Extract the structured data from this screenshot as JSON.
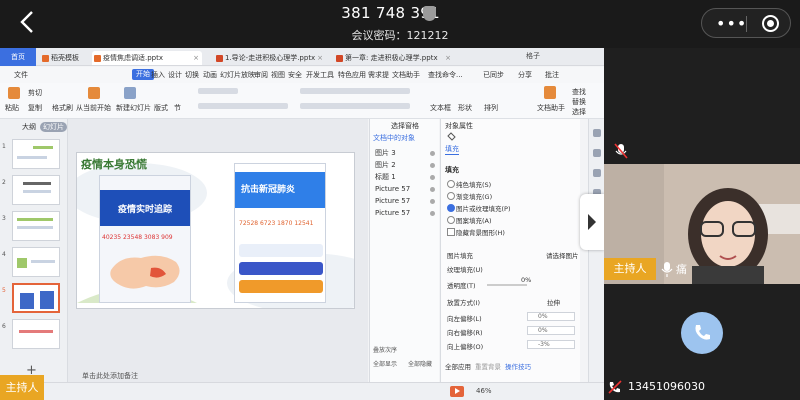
{
  "meeting": {
    "id": "381 748 391",
    "password_label": "会议密码：121212",
    "more_dots": "•••"
  },
  "wps": {
    "tabs": {
      "home": "首页",
      "dochub": "稻壳模板",
      "doc1": "疫情焦虑调适.pptx",
      "doc2": "1.导论-走进积极心理学.pptx",
      "doc3": "第一章: 走进积极心理学.pptx",
      "user": "格子"
    },
    "menus": [
      "文件",
      "开始",
      "插入",
      "设计",
      "切换",
      "动画",
      "幻灯片放映",
      "审阅",
      "视图",
      "安全",
      "开发工具",
      "特色应用",
      "需求提",
      "文档助手",
      "查找命令...",
      "已同步",
      "分享",
      "批注"
    ],
    "active_menu": "开始",
    "ribbon": {
      "paste": "粘贴",
      "cut": "剪切",
      "copy": "复制",
      "format_painter": "格式刷",
      "play_from_current": "从当前开始",
      "new_slide": "新建幻灯片",
      "layout": "版式",
      "section": "节",
      "textbox": "文本框",
      "shape": "形状",
      "arrange": "排列",
      "doc_helper": "文档助手",
      "find": "查找",
      "replace": "替换",
      "select": "选择"
    },
    "thumbs": {
      "outline_tab": "大纲",
      "slides_tab": "幻灯片",
      "numbers": [
        "1",
        "2",
        "3",
        "4",
        "5",
        "6"
      ]
    },
    "slide": {
      "title": "疫情本身恐慌",
      "phone_a_title": "疫情实时追踪",
      "phone_a_nums": "40235  23548  3083  909",
      "phone_b_title": "抗击新冠肺炎",
      "phone_b_nums": "72528  6723  1870  12541"
    },
    "notes_placeholder": "单击此处添加备注",
    "selection_pane": {
      "title": "选择窗格",
      "subtitle": "文档中的对象",
      "objects": [
        "图片 3",
        "图片 2",
        "标题 1",
        "Picture 57",
        "Picture 57",
        "Picture 57"
      ],
      "order_label": "叠放次序",
      "show_all": "全部显示",
      "hide_all": "全部隐藏"
    },
    "properties": {
      "title": "对象属性",
      "fill_tab": "填充",
      "fill_section": "填充",
      "options": [
        "纯色填充(S)",
        "渐变填充(G)",
        "图片或纹理填充(P)",
        "图案填充(A)"
      ],
      "selected_option": "图片或纹理填充(P)",
      "hide_bg": "隐藏背景图形(H)",
      "fill_label": "图片填充",
      "fill_value": "请选择图片",
      "texture_label": "纹理填充(U)",
      "transparency_label": "透明度(T)",
      "transparency_value": "0%",
      "placement_label": "放置方式(I)",
      "placement_value": "拉伸",
      "offset_left_label": "向左偏移(L)",
      "offset_left_value": "0%",
      "offset_right_label": "向右偏移(R)",
      "offset_right_value": "0%",
      "offset_up_label": "向上偏移(O)",
      "offset_up_value": "-3%",
      "apply_all": "全部应用",
      "reset_bg": "重置背景",
      "skills": "操作技巧"
    },
    "zoom": "46%"
  },
  "participants": {
    "host_label_left": "主持人",
    "host_label": "主持人",
    "host_name": "痛",
    "caller_number": "13451096030"
  },
  "colors": {
    "host_tag": "#e9a623",
    "wps_blue": "#3b6fe0",
    "slide_title": "#3a7a35"
  }
}
